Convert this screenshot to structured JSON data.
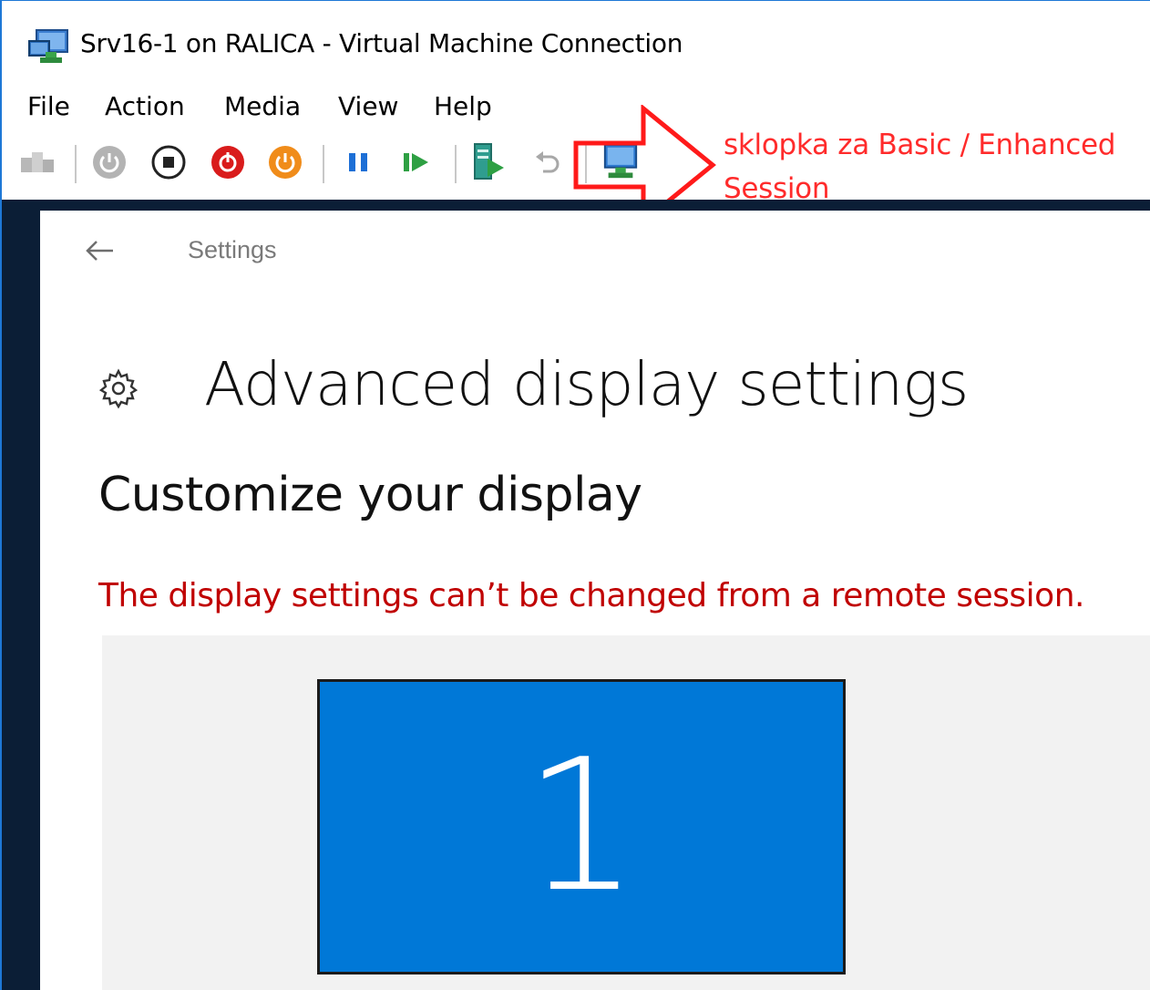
{
  "window": {
    "title": "Srv16-1 on RALICA - Virtual Machine Connection"
  },
  "menu": {
    "items": [
      "File",
      "Action",
      "Media",
      "View",
      "Help"
    ]
  },
  "toolbar": {
    "buttons": [
      "ctrl-alt-del-icon",
      "start-icon",
      "turn-off-icon",
      "shut-down-icon",
      "save-icon",
      "pause-icon",
      "resume-icon",
      "checkpoint-icon",
      "revert-icon",
      "enhanced-session-icon"
    ]
  },
  "annotation": {
    "text": "sklopka za Basic / Enhanced Session",
    "color": "#ff2b2b"
  },
  "vm": {
    "nav": {
      "back_icon": "back-arrow-icon",
      "title": "Settings"
    },
    "page_title": "Advanced display settings",
    "subtitle": "Customize your display",
    "warning": "The display settings can’t be changed from a remote session.",
    "monitor": {
      "number": "1",
      "color": "#0078d7"
    }
  }
}
